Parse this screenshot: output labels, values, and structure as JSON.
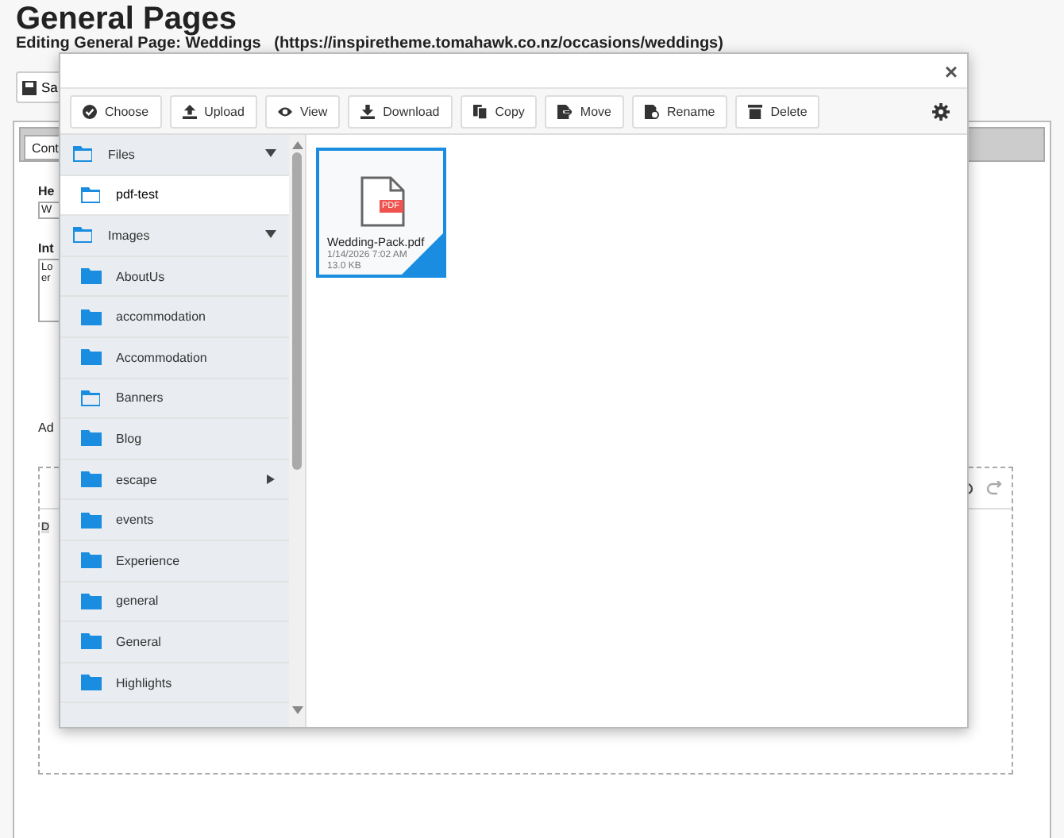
{
  "page": {
    "title": "General Pages",
    "subtitle": "Editing General Page: Weddings   (https://inspiretheme.tomahawk.co.nz/occasions/weddings)",
    "save_button": "Sa",
    "tab": "Cont",
    "heading_label": "He",
    "heading_value": "W",
    "intro_label": "Int",
    "intro_text": "Lo\ner",
    "additional_label": "Ad",
    "editor_text": "D"
  },
  "dialog": {
    "close": "×",
    "toolbar": [
      "Choose",
      "Upload",
      "View",
      "Download",
      "Copy",
      "Move",
      "Rename",
      "Delete"
    ],
    "tree": [
      {
        "name": "Files",
        "kind": "folder-open",
        "expanded": true,
        "selected": false,
        "children": [
          {
            "name": "pdf-test",
            "kind": "folder-open",
            "selected": true
          }
        ]
      },
      {
        "name": "Images",
        "kind": "folder-open",
        "expanded": true,
        "selected": false,
        "children": [
          {
            "name": "AboutUs",
            "kind": "folder",
            "selected": false
          },
          {
            "name": "accommodation",
            "kind": "folder",
            "selected": false
          },
          {
            "name": "Accommodation",
            "kind": "folder",
            "selected": false
          },
          {
            "name": "Banners",
            "kind": "folder-open",
            "selected": false
          },
          {
            "name": "Blog",
            "kind": "folder",
            "selected": false
          },
          {
            "name": "escape",
            "kind": "folder",
            "selected": false,
            "expanded": false
          },
          {
            "name": "events",
            "kind": "folder",
            "selected": false
          },
          {
            "name": "Experience",
            "kind": "folder",
            "selected": false
          },
          {
            "name": "general",
            "kind": "folder",
            "selected": false
          },
          {
            "name": "General",
            "kind": "folder",
            "selected": false
          },
          {
            "name": "Highlights",
            "kind": "folder",
            "selected": false
          }
        ]
      }
    ],
    "files": [
      {
        "name": "Wedding-Pack.pdf",
        "badge": "PDF",
        "date": "1/14/2026 7:02 AM",
        "size": "13.0 KB",
        "selected": true
      }
    ]
  }
}
